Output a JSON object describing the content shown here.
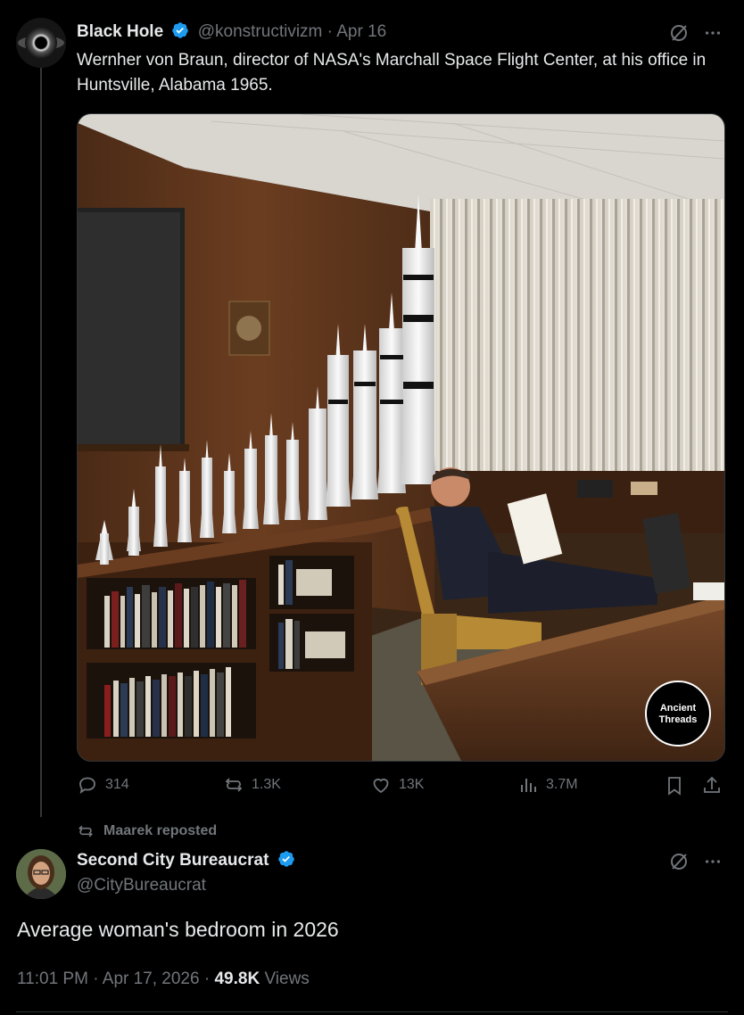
{
  "tweet1": {
    "author_name": "Black Hole",
    "handle": "@konstructivizm",
    "separator": "·",
    "date": "Apr 16",
    "text": "Wernher von Braun, director of NASA's Marchall Space Flight Center, at his office in Huntsville, Alabama 1965.",
    "watermark_line1": "Ancient",
    "watermark_line2": "Threads",
    "stats": {
      "replies": "314",
      "reposts": "1.3K",
      "likes": "13K",
      "views": "3.7M"
    }
  },
  "repost_label": "Maarek reposted",
  "tweet2": {
    "author_name": "Second City Bureaucrat",
    "handle": "@CityBureaucrat",
    "text": "Average woman's bedroom in 2026",
    "time": "11:01 PM",
    "sep1": "·",
    "date": "Apr 17, 2026",
    "sep2": "·",
    "views_count": "49.8K",
    "views_label": "Views"
  },
  "colors": {
    "verified": "#1d9bf0",
    "muted": "#71767b",
    "text": "#e7e9ea"
  },
  "icons": [
    "grok-icon",
    "more-icon",
    "reply-icon",
    "repost-icon",
    "like-icon",
    "views-icon",
    "bookmark-icon",
    "share-icon",
    "verified-badge-icon"
  ]
}
